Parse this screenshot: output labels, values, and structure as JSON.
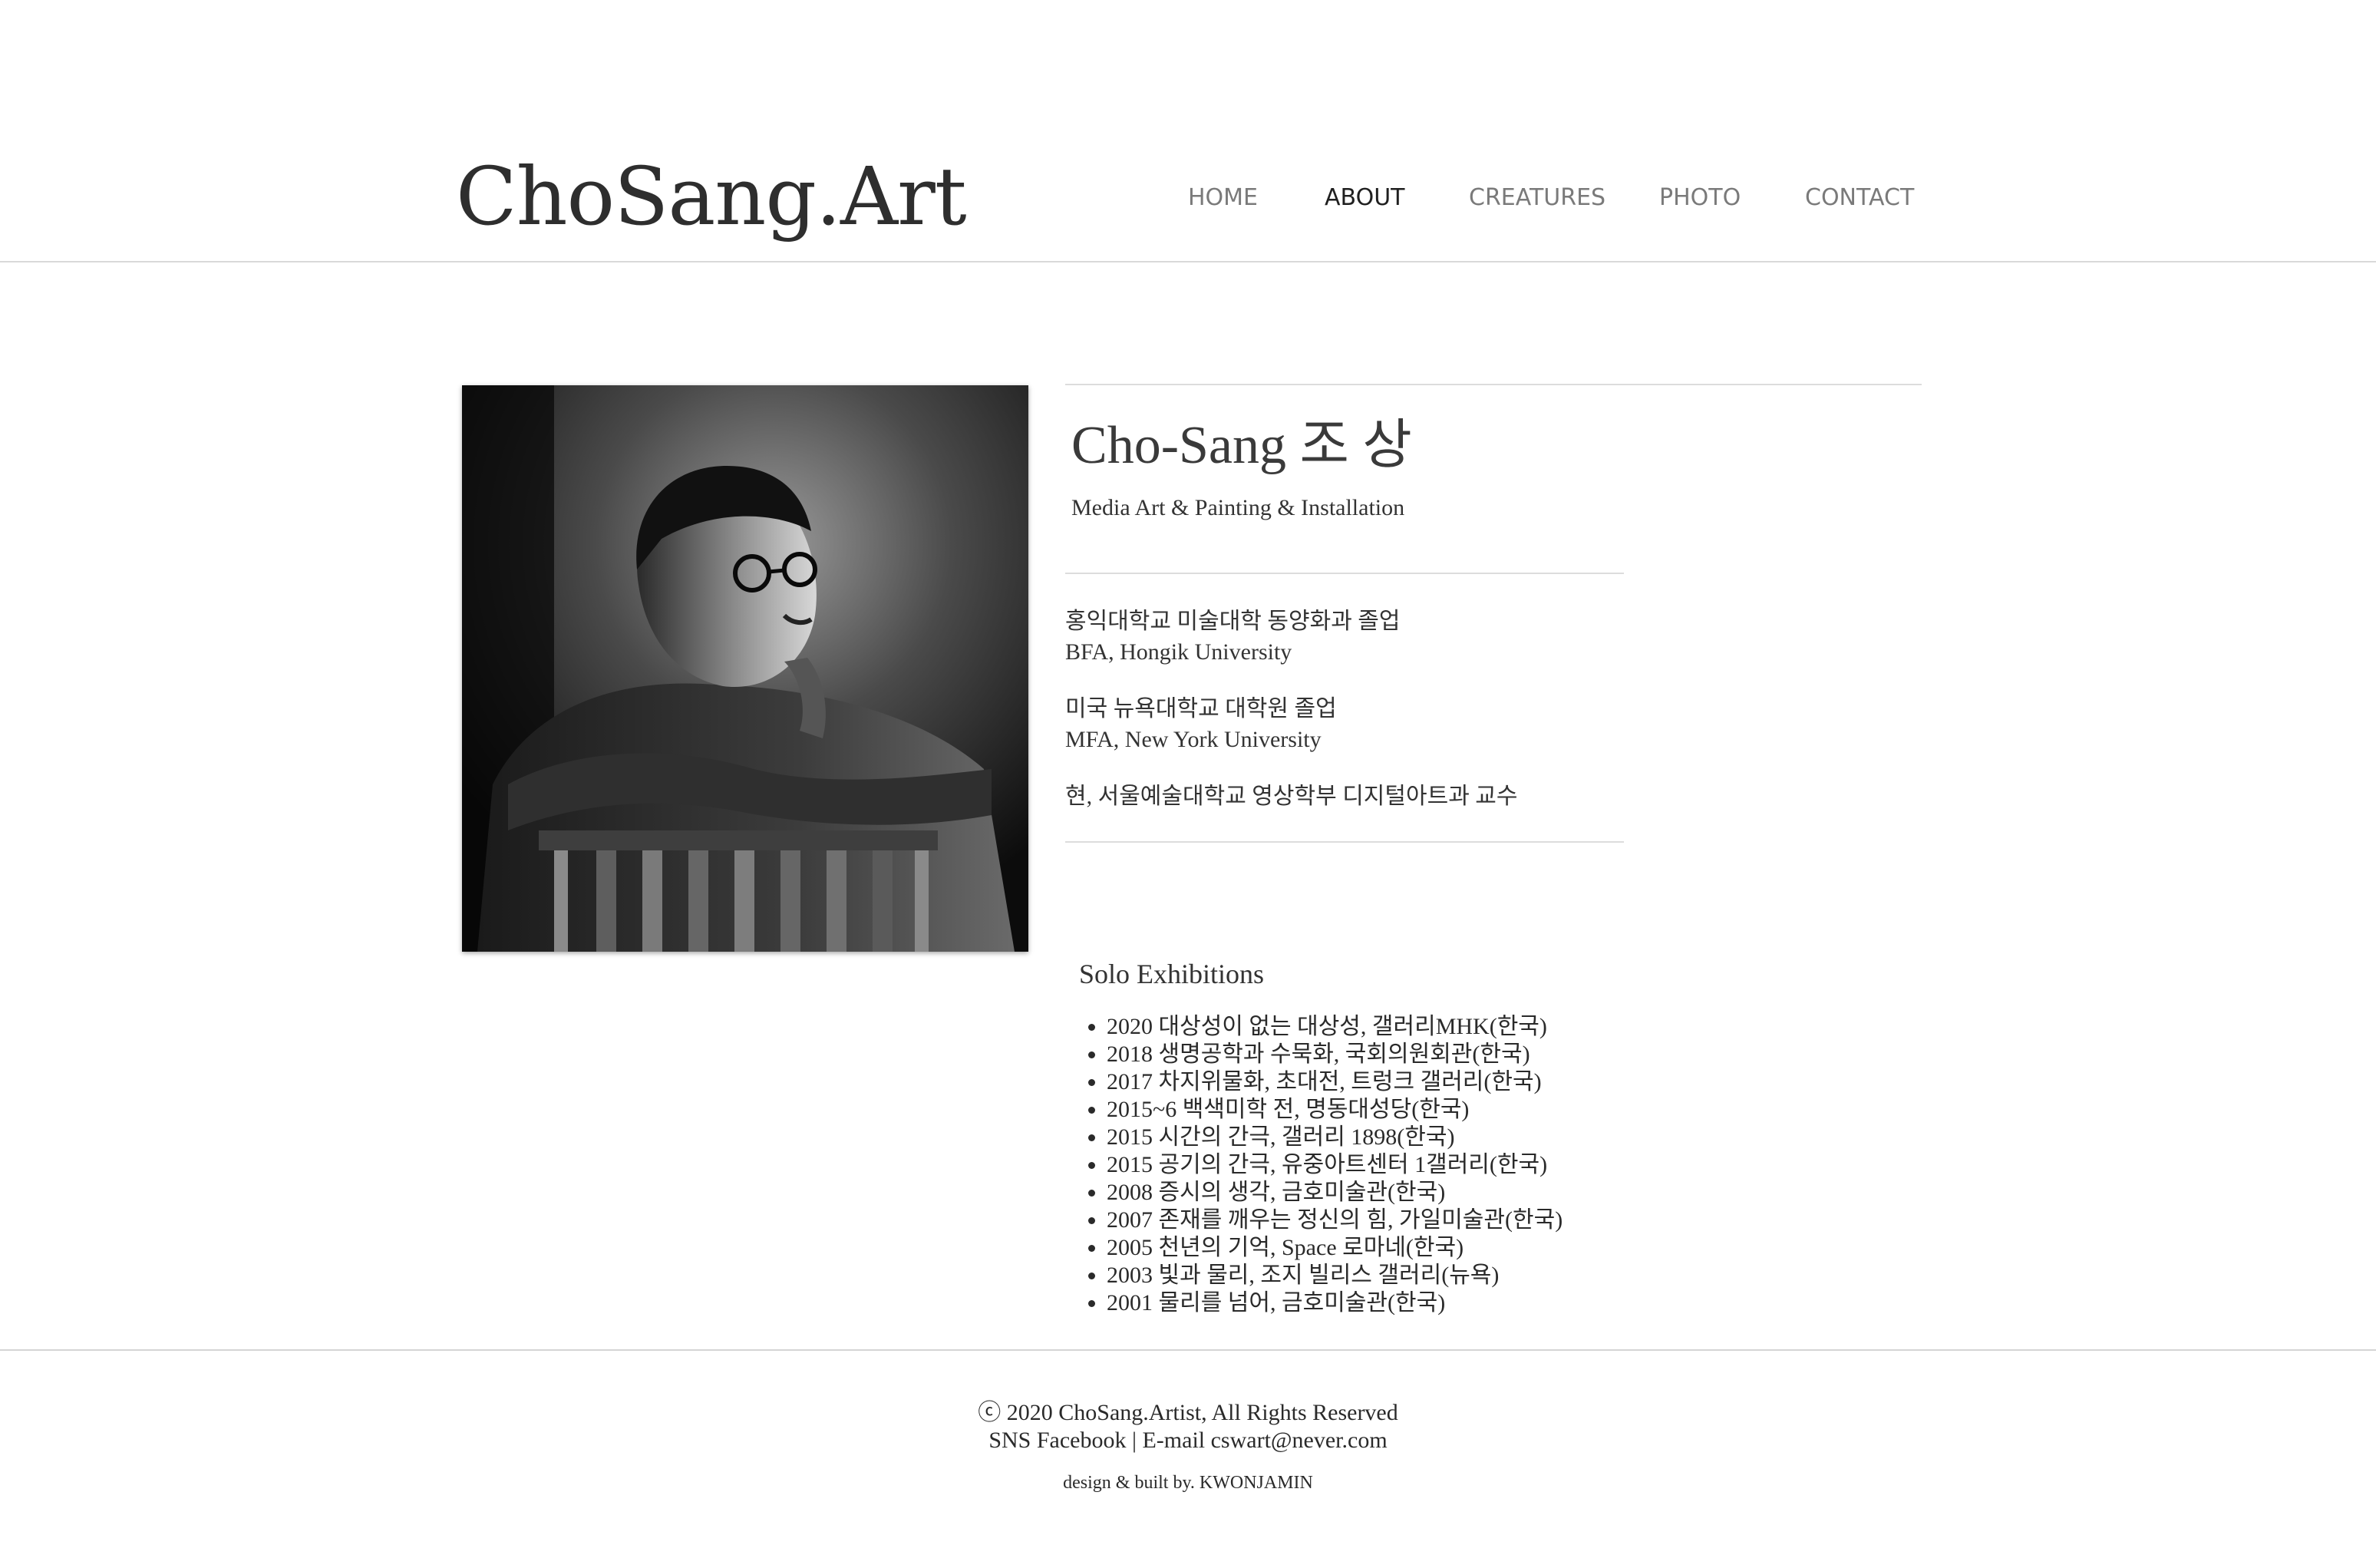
{
  "site": {
    "logo": "ChoSang.Art"
  },
  "nav": {
    "items": [
      {
        "label": "HOME",
        "active": false
      },
      {
        "label": "ABOUT",
        "active": true
      },
      {
        "label": "CREATURES",
        "active": false
      },
      {
        "label": "PHOTO",
        "active": false
      },
      {
        "label": "CONTACT",
        "active": false
      }
    ]
  },
  "profile": {
    "name": "Cho-Sang 조 상",
    "subtitle": "Media Art & Painting & Installation",
    "education": [
      {
        "korean": "홍익대학교 미술대학 동양화과 졸업",
        "english": "BFA, Hongik University"
      },
      {
        "korean": "미국 뉴욕대학교 대학원 졸업",
        "english": "MFA, New York University"
      }
    ],
    "current_position": "현, 서울예술대학교 영상학부 디지털아트과 교수"
  },
  "solo": {
    "title": "Solo Exhibitions",
    "items": [
      "2020 대상성이 없는 대상성, 갤러리MHK(한국)",
      "2018 생명공학과 수묵화,  국회의원회관(한국)",
      "2017 차지위물화, 초대전,  트렁크 갤러리(한국)",
      "2015~6 백색미학 전,  명동대성당(한국)",
      "2015 시간의 간극, 갤러리 1898(한국)",
      "2015 공기의 간극, 유중아트센터 1갤러리(한국)",
      "2008 증시의 생각, 금호미술관(한국)",
      "2007 존재를 깨우는 정신의 힘, 가일미술관(한국)",
      "2005 천년의 기억, Space 로마네(한국)",
      "2003 빛과 물리, 조지 빌리스 갤러리(뉴욕)",
      "2001 물리를 넘어, 금호미술관(한국)"
    ]
  },
  "footer": {
    "copyright": "ⓒ 2020 ChoSang.Artist, All Rights Reserved",
    "contact": "SNS Facebook | E-mail cswart@never.com",
    "credit": "design & built by. KWONJAMIN"
  },
  "colors": {
    "text": "#333333",
    "nav_inactive": "#7a7a7a",
    "nav_active": "#1f1f1f",
    "divider": "#dcdcdc"
  }
}
